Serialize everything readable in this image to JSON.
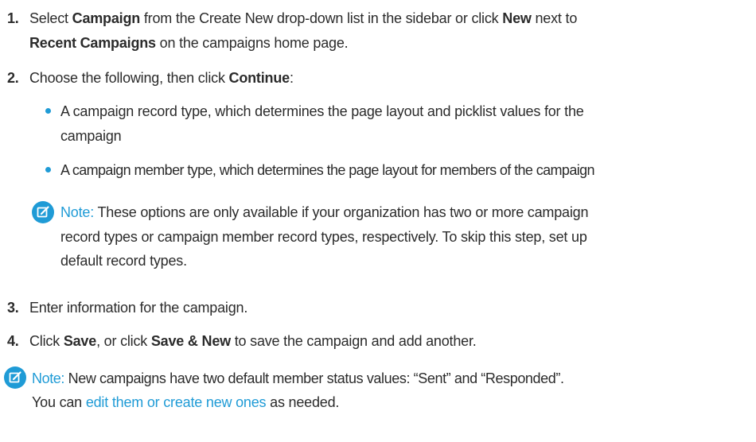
{
  "steps": [
    {
      "number": "1.",
      "line1_a": "Select ",
      "line1_b": "Campaign",
      "line1_c": " from the Create New drop-down list in the sidebar or click ",
      "line1_d": "New",
      "line1_e": " next to",
      "line2_a": "Recent Campaigns",
      "line2_b": " on the campaigns home page."
    },
    {
      "number": "2.",
      "line1_a": "Choose the following, then click ",
      "line1_b": "Continue",
      "line1_c": ":",
      "bullets": [
        {
          "line1": "A campaign record type, which determines the page layout and picklist values for the",
          "line2": "campaign"
        },
        {
          "line1": "A campaign member type, which determines the page layout for members of the campaign"
        }
      ],
      "note": {
        "icon": "note-edit-icon",
        "label": "Note:",
        "line1": " These options are only available if your organization has two or more campaign",
        "line2": "record types or campaign member record types, respectively. To skip this step, set up",
        "line3": "default record types."
      }
    },
    {
      "number": "3.",
      "text": "Enter information for the campaign."
    },
    {
      "number": "4.",
      "a": "Click ",
      "b": "Save",
      "c": ", or click ",
      "d": "Save & New",
      "e": " to save the campaign and add another."
    }
  ],
  "footer_note": {
    "icon": "note-edit-icon",
    "label": "Note:",
    "line1": " New campaigns have two default member status values: “Sent” and “Responded”.",
    "line2_a": "You can ",
    "line2_link": "edit them or create new ones",
    "line2_b": " as needed."
  },
  "colors": {
    "accent": "#1f9bd6",
    "text": "#2b2b2b"
  }
}
